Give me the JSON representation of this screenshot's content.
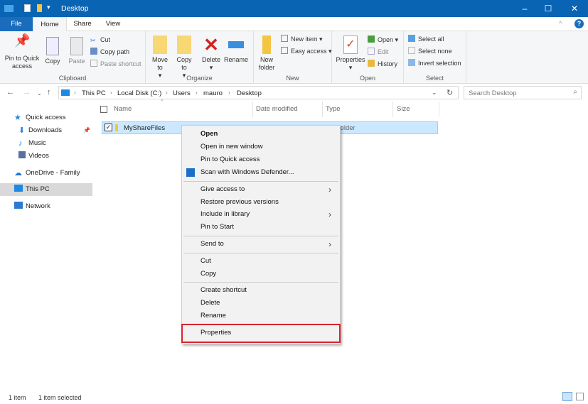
{
  "window": {
    "title": "Desktop",
    "minimize": "–",
    "maximize": "☐",
    "close": "✕"
  },
  "tabs": {
    "file": "File",
    "home": "Home",
    "share": "Share",
    "view": "View"
  },
  "ribbon": {
    "clipboard": {
      "label": "Clipboard",
      "pin": "Pin to Quick access",
      "copy": "Copy",
      "paste": "Paste",
      "cut": "Cut",
      "copy_path": "Copy path",
      "paste_shortcut": "Paste shortcut"
    },
    "organize": {
      "label": "Organize",
      "move_to": "Move to",
      "copy_to": "Copy to",
      "delete": "Delete",
      "rename": "Rename"
    },
    "new": {
      "label": "New",
      "new_folder": "New folder",
      "new_item": "New item ▾",
      "easy_access": "Easy access ▾"
    },
    "open": {
      "label": "Open",
      "properties": "Properties",
      "open": "Open ▾",
      "edit": "Edit",
      "history": "History"
    },
    "select": {
      "label": "Select",
      "select_all": "Select all",
      "select_none": "Select none",
      "invert": "Invert selection"
    }
  },
  "address": {
    "crumbs": [
      "This PC",
      "Local Disk (C:)",
      "Users",
      "mauro",
      "Desktop"
    ],
    "search_placeholder": "Search Desktop"
  },
  "sidebar": {
    "items": [
      "Quick access",
      "Downloads",
      "Music",
      "Videos",
      "OneDrive - Family",
      "This PC",
      "Network"
    ]
  },
  "columns": {
    "name": "Name",
    "date": "Date modified",
    "type": "Type",
    "size": "Size"
  },
  "file": {
    "name": "MyShareFiles",
    "type": "File folder"
  },
  "context_menu": {
    "items": [
      "Open",
      "Open in new window",
      "Pin to Quick access",
      "Scan with Windows Defender...",
      "Give access to",
      "Restore previous versions",
      "Include in library",
      "Pin to Start",
      "Send to",
      "Cut",
      "Copy",
      "Create shortcut",
      "Delete",
      "Rename",
      "Properties"
    ]
  },
  "status": {
    "count": "1 item",
    "selected": "1 item selected"
  },
  "colors": {
    "title": "#0a64b4",
    "highlight": "#d9232e"
  }
}
